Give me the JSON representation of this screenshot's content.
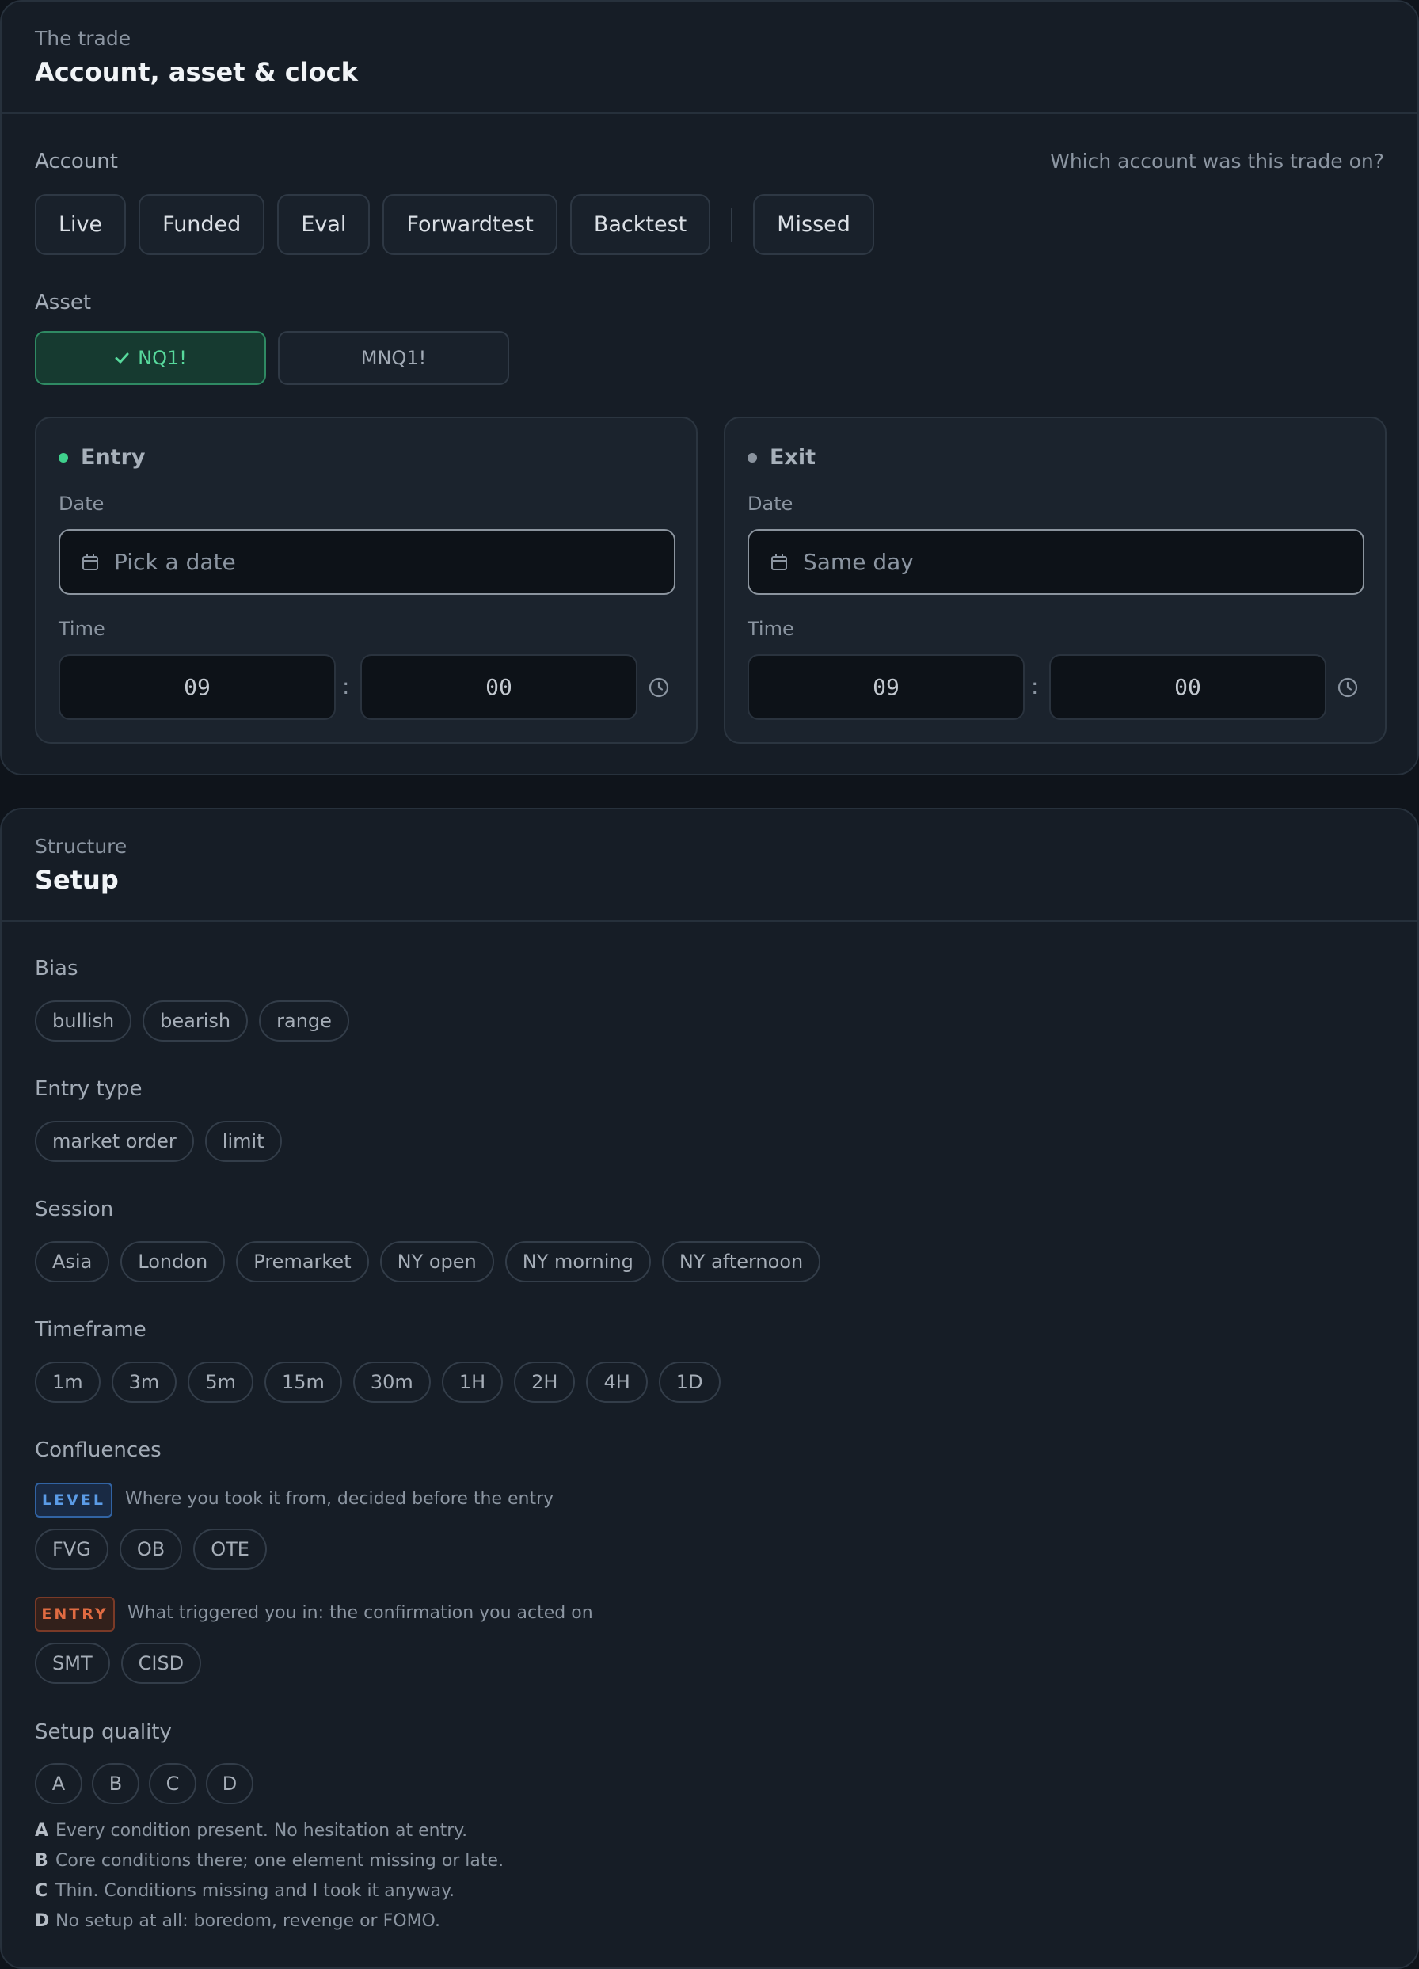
{
  "trade": {
    "eyebrow": "The trade",
    "title": "Account, asset & clock",
    "account_label": "Account",
    "account_helper": "Which account was this trade on?",
    "accounts": [
      "Live",
      "Funded",
      "Eval",
      "Forwardtest",
      "Backtest"
    ],
    "account_extra": "Missed",
    "asset_label": "Asset",
    "assets": [
      {
        "label": "NQ1!",
        "selected": true
      },
      {
        "label": "MNQ1!",
        "selected": false
      }
    ],
    "entry": {
      "title": "Entry",
      "date_label": "Date",
      "date_placeholder": "Pick a date",
      "time_label": "Time",
      "hour": "09",
      "minute": "00",
      "separator": ":"
    },
    "exit": {
      "title": "Exit",
      "date_label": "Date",
      "date_placeholder": "Same day",
      "time_label": "Time",
      "hour": "09",
      "minute": "00",
      "separator": ":"
    }
  },
  "setup": {
    "eyebrow": "Structure",
    "title": "Setup",
    "bias": {
      "label": "Bias",
      "options": [
        "bullish",
        "bearish",
        "range"
      ]
    },
    "entry_type": {
      "label": "Entry type",
      "options": [
        "market order",
        "limit"
      ]
    },
    "session": {
      "label": "Session",
      "options": [
        "Asia",
        "London",
        "Premarket",
        "NY open",
        "NY morning",
        "NY afternoon"
      ]
    },
    "timeframe": {
      "label": "Timeframe",
      "options": [
        "1m",
        "3m",
        "5m",
        "15m",
        "30m",
        "1H",
        "2H",
        "4H",
        "1D"
      ]
    },
    "confluences": {
      "label": "Confluences",
      "level": {
        "tag": "LEVEL",
        "description": "Where you took it from, decided before the entry",
        "options": [
          "FVG",
          "OB",
          "OTE"
        ]
      },
      "entry": {
        "tag": "ENTRY",
        "description": "What triggered you in: the confirmation you acted on",
        "options": [
          "SMT",
          "CISD"
        ]
      }
    },
    "quality": {
      "label": "Setup quality",
      "options": [
        "A",
        "B",
        "C",
        "D"
      ],
      "legend": [
        {
          "key": "A",
          "text": "Every condition present. No hesitation at entry."
        },
        {
          "key": "B",
          "text": "Core conditions there; one element missing or late."
        },
        {
          "key": "C",
          "text": "Thin. Conditions missing and I took it anyway."
        },
        {
          "key": "D",
          "text": "No setup at all: boredom, revenge or FOMO."
        }
      ]
    }
  },
  "colors": {
    "background": "#0f141b",
    "card": "#161d26",
    "accent_green": "#57d99c",
    "level_blue": "#5b9be6",
    "entry_orange": "#e06b42"
  },
  "icons": [
    "check-icon",
    "calendar-icon",
    "clock-icon"
  ]
}
